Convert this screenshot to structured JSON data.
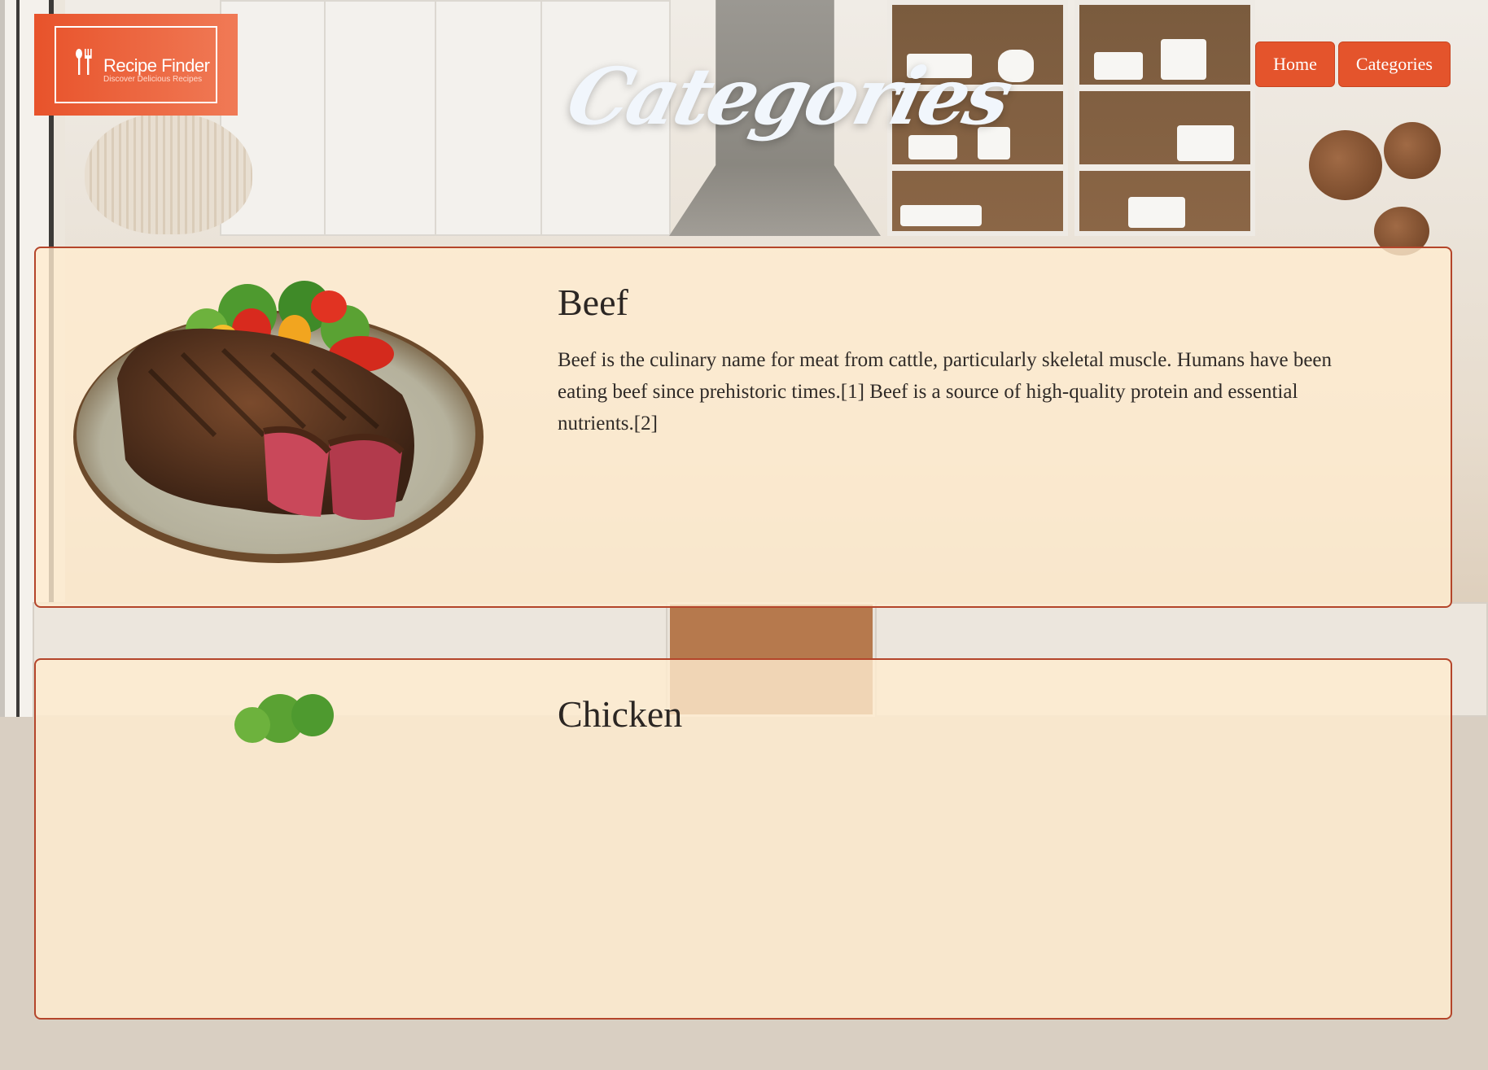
{
  "header": {
    "logo_title": "Recipe Finder",
    "logo_tagline": "Discover Delicious Recipes",
    "page_title": "Categories",
    "nav": [
      {
        "label": "Home"
      },
      {
        "label": "Categories"
      }
    ]
  },
  "categories": [
    {
      "name": "Beef",
      "description": "Beef is the culinary name for meat from cattle, particularly skeletal muscle. Humans have been eating beef since prehistoric times.[1] Beef is a source of high-quality protein and essential nutrients.[2]",
      "image_icon": "steak-plate-image"
    },
    {
      "name": "Chicken",
      "description": "",
      "image_icon": "chicken-dish-image"
    }
  ],
  "colors": {
    "accent": "#e4542c",
    "card_bg": "#ffecd0",
    "card_border": "#b4452a",
    "title": "#f1f6fc"
  }
}
